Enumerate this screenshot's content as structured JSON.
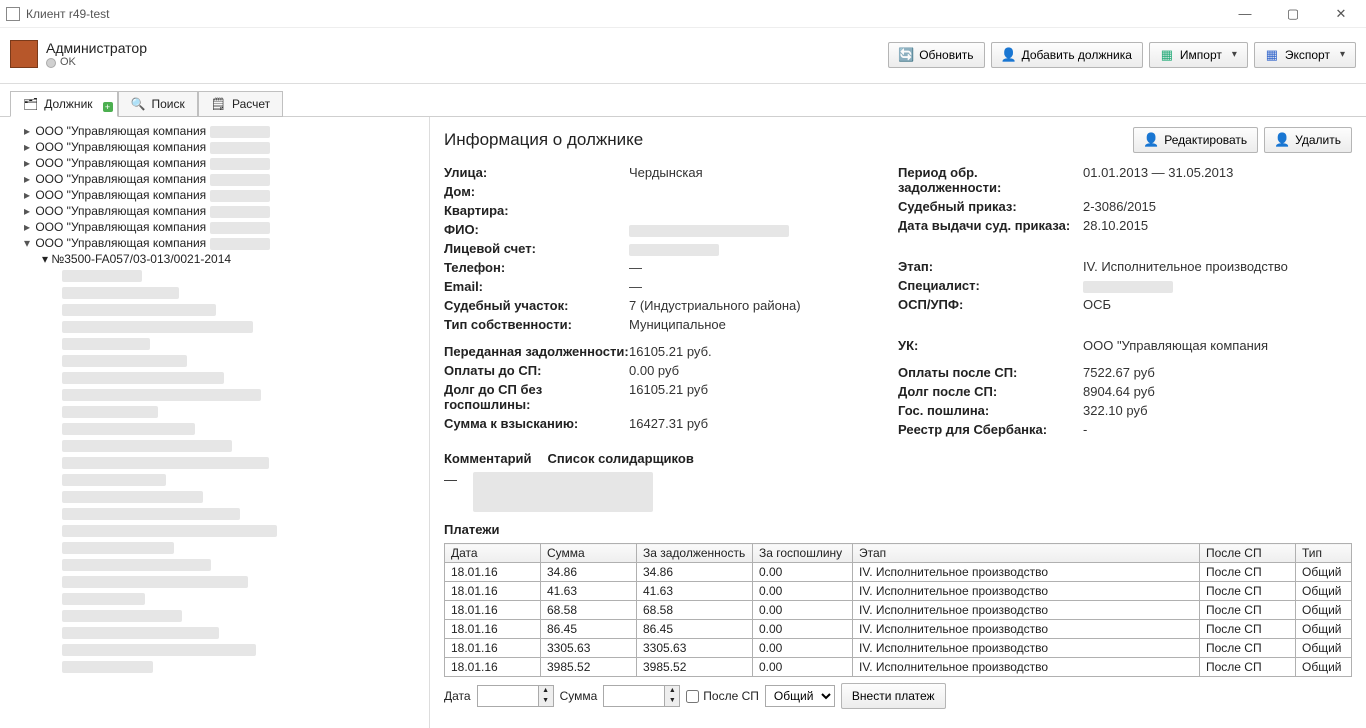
{
  "window": {
    "title": "Клиент r49-test"
  },
  "user": {
    "name": "Администратор",
    "status": "OK"
  },
  "toolbar": {
    "refresh": "Обновить",
    "add_debtor": "Добавить должника",
    "import": "Импорт",
    "export": "Экспорт"
  },
  "tabs": {
    "debtor": "Должник",
    "search": "Поиск",
    "calc": "Расчет"
  },
  "tree": {
    "company_prefix": "ООО \"Управляющая компания",
    "items": [
      "ООО \"Управляющая компания",
      "ООО \"Управляющая компания",
      "ООО \"Управляющая компания",
      "ООО \"Управляющая компания",
      "ООО \"Управляющая компания",
      "ООО \"Управляющая компания",
      "ООО \"Управляющая компания",
      "ООО \"Управляющая компания"
    ],
    "expanded_child": "№3500-FA057/03-013/0021-2014"
  },
  "main": {
    "title": "Информация о должнике",
    "buttons": {
      "edit": "Редактировать",
      "delete": "Удалить"
    },
    "left": {
      "street_l": "Улица:",
      "street_v": "Чердынская",
      "house_l": "Дом:",
      "house_v": "",
      "flat_l": "Квартира:",
      "flat_v": "",
      "fio_l": "ФИО:",
      "fio_v": "",
      "account_l": "Лицевой счет:",
      "account_v": "",
      "phone_l": "Телефон:",
      "phone_v": "—",
      "email_l": "Email:",
      "email_v": "—",
      "court_l": "Судебный участок:",
      "court_v": "7 (Индустриального района)",
      "ownertype_l": "Тип собственности:",
      "ownertype_v": "Муниципальное",
      "transferred_l": "Переданная задолженности:",
      "transferred_v": "16105.21 руб.",
      "pay_before_l": "Оплаты до СП:",
      "pay_before_v": "0.00 руб",
      "debt_before_l": "Долг до СП без госпошлины:",
      "debt_before_v": "16105.21 руб",
      "collect_l": "Сумма к взысканию:",
      "collect_v": "16427.31 руб"
    },
    "right": {
      "period_l": "Период обр. задолженности:",
      "period_v": "01.01.2013 — 31.05.2013",
      "order_l": "Судебный приказ:",
      "order_v": "2-3086/2015",
      "orderdate_l": "Дата выдачи суд. приказа:",
      "orderdate_v": "28.10.2015",
      "stage_l": "Этап:",
      "stage_v": "IV. Исполнительное производство",
      "spec_l": "Специалист:",
      "spec_v": "",
      "osp_l": "ОСП/УПФ:",
      "osp_v": "ОСБ",
      "uk_l": "УК:",
      "uk_v": "ООО \"Управляющая компания",
      "pay_after_l": "Оплаты после СП:",
      "pay_after_v": "7522.67 руб",
      "debt_after_l": "Долг после СП:",
      "debt_after_v": "8904.64 руб",
      "fee_l": "Гос. пошлина:",
      "fee_v": "322.10 руб",
      "sber_l": "Реестр для Сбербанка:",
      "sber_v": "-"
    },
    "comment_l": "Комментарий",
    "solidar_l": "Список солидарщиков",
    "comment_v": "—",
    "payments_title": "Платежи",
    "payments": {
      "headers": {
        "date": "Дата",
        "sum": "Сумма",
        "debt": "За задолженность",
        "fee": "За госпошлину",
        "stage": "Этап",
        "after_sp": "После СП",
        "type": "Тип"
      },
      "rows": [
        {
          "date": "18.01.16",
          "sum": "34.86",
          "debt": "34.86",
          "fee": "0.00",
          "stage": "IV. Исполнительное производство",
          "after_sp": "После СП",
          "type": "Общий"
        },
        {
          "date": "18.01.16",
          "sum": "41.63",
          "debt": "41.63",
          "fee": "0.00",
          "stage": "IV. Исполнительное производство",
          "after_sp": "После СП",
          "type": "Общий"
        },
        {
          "date": "18.01.16",
          "sum": "68.58",
          "debt": "68.58",
          "fee": "0.00",
          "stage": "IV. Исполнительное производство",
          "after_sp": "После СП",
          "type": "Общий"
        },
        {
          "date": "18.01.16",
          "sum": "86.45",
          "debt": "86.45",
          "fee": "0.00",
          "stage": "IV. Исполнительное производство",
          "after_sp": "После СП",
          "type": "Общий"
        },
        {
          "date": "18.01.16",
          "sum": "3305.63",
          "debt": "3305.63",
          "fee": "0.00",
          "stage": "IV. Исполнительное производство",
          "after_sp": "После СП",
          "type": "Общий"
        },
        {
          "date": "18.01.16",
          "sum": "3985.52",
          "debt": "3985.52",
          "fee": "0.00",
          "stage": "IV. Исполнительное производство",
          "after_sp": "После СП",
          "type": "Общий"
        }
      ]
    },
    "footer": {
      "date_l": "Дата",
      "sum_l": "Сумма",
      "after_sp_l": "После СП",
      "type_v": "Общий",
      "submit": "Внести платеж"
    }
  }
}
